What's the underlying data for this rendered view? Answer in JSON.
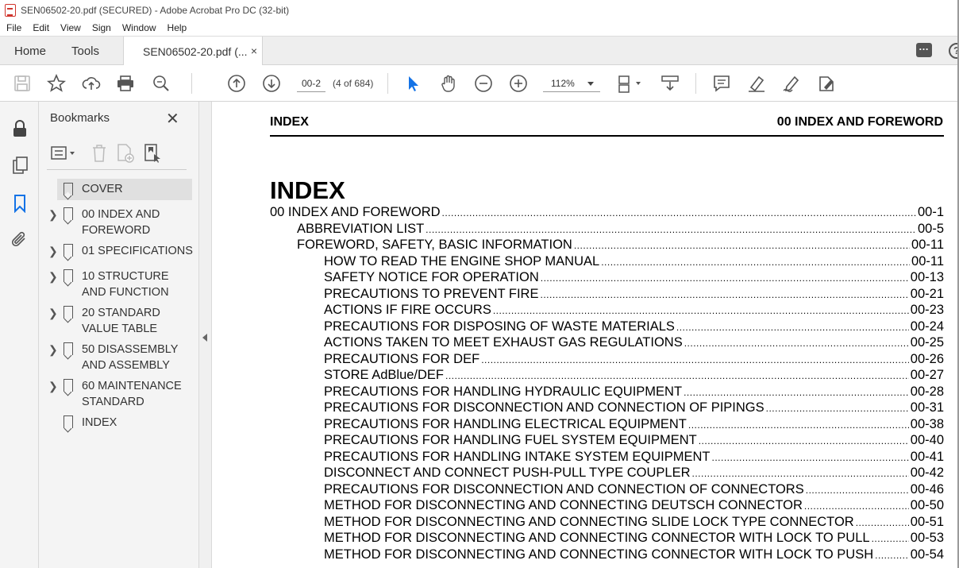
{
  "window": {
    "title": "SEN06502-20.pdf (SECURED) - Adobe Acrobat Pro DC (32-bit)"
  },
  "menu": [
    "File",
    "Edit",
    "View",
    "Sign",
    "Window",
    "Help"
  ],
  "tabs": {
    "home": "Home",
    "tools": "Tools",
    "document": "SEN06502-20.pdf (...",
    "close": "×"
  },
  "toolbar": {
    "page_value": "00-2",
    "page_count": "(4 of 684)",
    "zoom": "112%"
  },
  "icons": {
    "save": "save-icon",
    "bookmark": "star-icon",
    "upload": "upload-icon",
    "print": "printer-icon",
    "find": "zoom-search-icon",
    "prev": "arrow-up-icon",
    "next": "arrow-down-icon",
    "select": "cursor-icon",
    "hand": "hand-icon",
    "zoom_out": "minus-circle-icon",
    "zoom_in": "plus-circle-icon",
    "page_display": "page-display-icon",
    "scroll": "scroll-icon",
    "comment": "comment-icon",
    "highlight": "highlight-pen-icon",
    "sign": "sign-pen-icon",
    "fill": "fill-sign-icon",
    "lock": "lock-icon",
    "pages": "pages-icon",
    "bookmarks": "bookmark-ribbon-icon",
    "attach": "paperclip-icon"
  },
  "bookmarks_panel": {
    "title": "Bookmarks",
    "close": "✕",
    "items": [
      {
        "label": "COVER",
        "expandable": false,
        "selected": true
      },
      {
        "label": "00 INDEX AND FOREWORD",
        "expandable": true
      },
      {
        "label": "01 SPECIFICATIONS",
        "expandable": true
      },
      {
        "label": "10 STRUCTURE AND FUNCTION",
        "expandable": true
      },
      {
        "label": "20 STANDARD VALUE TABLE",
        "expandable": true
      },
      {
        "label": "50 DISASSEMBLY AND ASSEMBLY",
        "expandable": true
      },
      {
        "label": "60 MAINTENANCE STANDARD",
        "expandable": true
      },
      {
        "label": "INDEX",
        "expandable": false
      }
    ]
  },
  "document": {
    "header_left": "INDEX",
    "header_right": "00 INDEX AND FOREWORD",
    "title": "INDEX",
    "toc": [
      {
        "level": 0,
        "text": "00 INDEX AND FOREWORD",
        "page": "00-1"
      },
      {
        "level": 1,
        "text": "ABBREVIATION LIST",
        "page": "00-5"
      },
      {
        "level": 1,
        "text": "FOREWORD, SAFETY, BASIC INFORMATION",
        "page": "00-11"
      },
      {
        "level": 2,
        "text": "HOW TO READ THE ENGINE SHOP MANUAL",
        "page": "00-11"
      },
      {
        "level": 2,
        "text": "SAFETY NOTICE FOR OPERATION",
        "page": "00-13"
      },
      {
        "level": 2,
        "text": "PRECAUTIONS TO PREVENT FIRE",
        "page": "00-21"
      },
      {
        "level": 2,
        "text": "ACTIONS IF FIRE OCCURS",
        "page": "00-23"
      },
      {
        "level": 2,
        "text": "PRECAUTIONS FOR DISPOSING OF WASTE MATERIALS",
        "page": "00-24"
      },
      {
        "level": 2,
        "text": "ACTIONS TAKEN TO MEET EXHAUST GAS REGULATIONS",
        "page": "00-25"
      },
      {
        "level": 2,
        "text": "PRECAUTIONS FOR DEF",
        "page": "00-26"
      },
      {
        "level": 2,
        "text": "STORE AdBlue/DEF",
        "page": "00-27"
      },
      {
        "level": 2,
        "text": "PRECAUTIONS FOR HANDLING HYDRAULIC EQUIPMENT",
        "page": "00-28"
      },
      {
        "level": 2,
        "text": "PRECAUTIONS FOR DISCONNECTION AND CONNECTION OF PIPINGS",
        "page": "00-31"
      },
      {
        "level": 2,
        "text": "PRECAUTIONS FOR HANDLING ELECTRICAL EQUIPMENT",
        "page": "00-38"
      },
      {
        "level": 2,
        "text": "PRECAUTIONS FOR HANDLING FUEL SYSTEM EQUIPMENT",
        "page": "00-40"
      },
      {
        "level": 2,
        "text": "PRECAUTIONS FOR HANDLING INTAKE SYSTEM EQUIPMENT",
        "page": "00-41"
      },
      {
        "level": 2,
        "text": "DISCONNECT AND CONNECT PUSH-PULL TYPE COUPLER",
        "page": "00-42"
      },
      {
        "level": 2,
        "text": "PRECAUTIONS FOR DISCONNECTION AND CONNECTION OF CONNECTORS",
        "page": "00-46"
      },
      {
        "level": 2,
        "text": "METHOD FOR DISCONNECTING AND CONNECTING DEUTSCH CONNECTOR",
        "page": "00-50"
      },
      {
        "level": 2,
        "text": "METHOD FOR DISCONNECTING AND CONNECTING SLIDE LOCK TYPE CONNECTOR",
        "page": "00-51"
      },
      {
        "level": 2,
        "text": "METHOD FOR DISCONNECTING AND CONNECTING CONNECTOR WITH LOCK TO PULL",
        "page": "00-53"
      },
      {
        "level": 2,
        "text": "METHOD FOR DISCONNECTING AND CONNECTING CONNECTOR WITH LOCK TO PUSH",
        "page": "00-54"
      }
    ]
  },
  "colors": {
    "accent": "#1473e6",
    "pdf_red": "#d0342c"
  }
}
